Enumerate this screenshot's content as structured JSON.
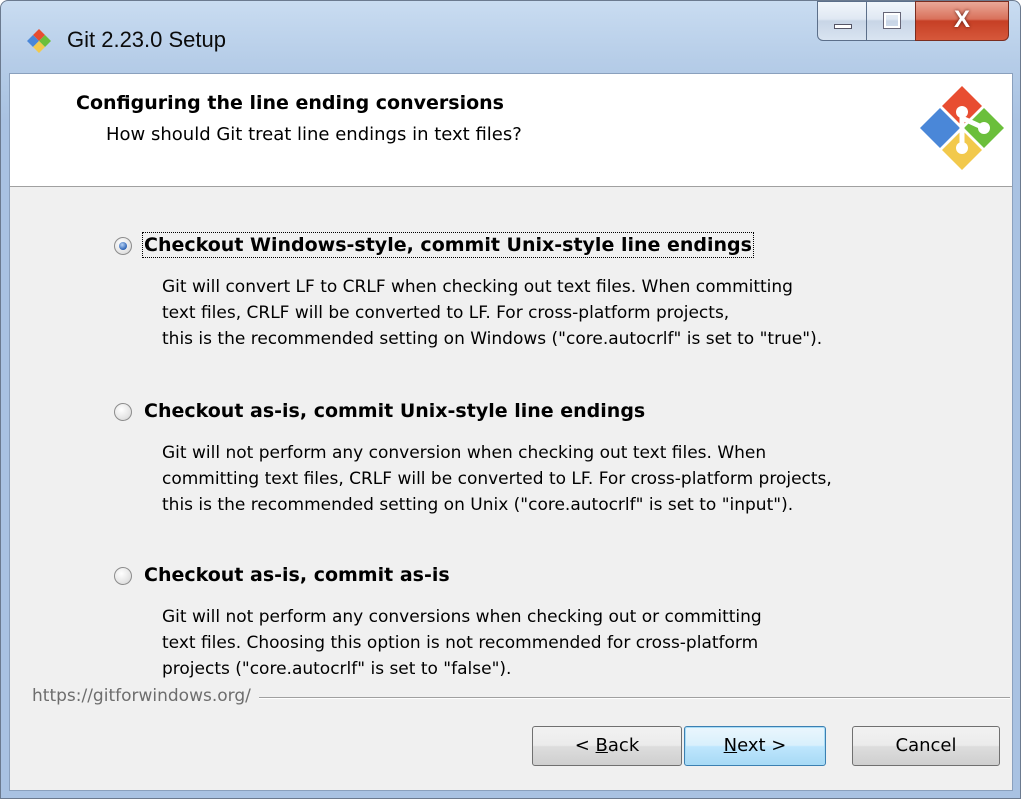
{
  "window": {
    "title": "Git 2.23.0 Setup",
    "close_glyph": "X"
  },
  "header": {
    "title": "Configuring the line ending conversions",
    "subtitle": "How should Git treat line endings in text files?"
  },
  "options": [
    {
      "label": "Checkout Windows-style, commit Unix-style line endings",
      "checked": true,
      "description": [
        "Git will convert LF to CRLF when checking out text files. When committing",
        "text files, CRLF will be converted to LF. For cross-platform projects,",
        "this is the recommended setting on Windows (\"core.autocrlf\" is set to \"true\")."
      ]
    },
    {
      "label": "Checkout as-is, commit Unix-style line endings",
      "checked": false,
      "description": [
        "Git will not perform any conversion when checking out text files. When",
        "committing text files, CRLF will be converted to LF. For cross-platform projects,",
        "this is the recommended setting on Unix (\"core.autocrlf\" is set to \"input\")."
      ]
    },
    {
      "label": "Checkout as-is, commit as-is",
      "checked": false,
      "description": [
        "Git will not perform any conversions when checking out or committing",
        "text files. Choosing this option is not recommended for cross-platform",
        "projects (\"core.autocrlf\" is set to \"false\")."
      ]
    }
  ],
  "footer": {
    "url": "https://gitforwindows.org/"
  },
  "buttons": {
    "back_prefix": "< ",
    "back_mnemonic": "B",
    "back_rest": "ack",
    "next_mnemonic": "N",
    "next_rest": "ext >",
    "cancel": "Cancel"
  },
  "colors": {
    "git_red": "#e84d31",
    "git_green": "#6bbf3b",
    "git_blue": "#4a87d8",
    "git_yellow": "#f2c94c"
  }
}
